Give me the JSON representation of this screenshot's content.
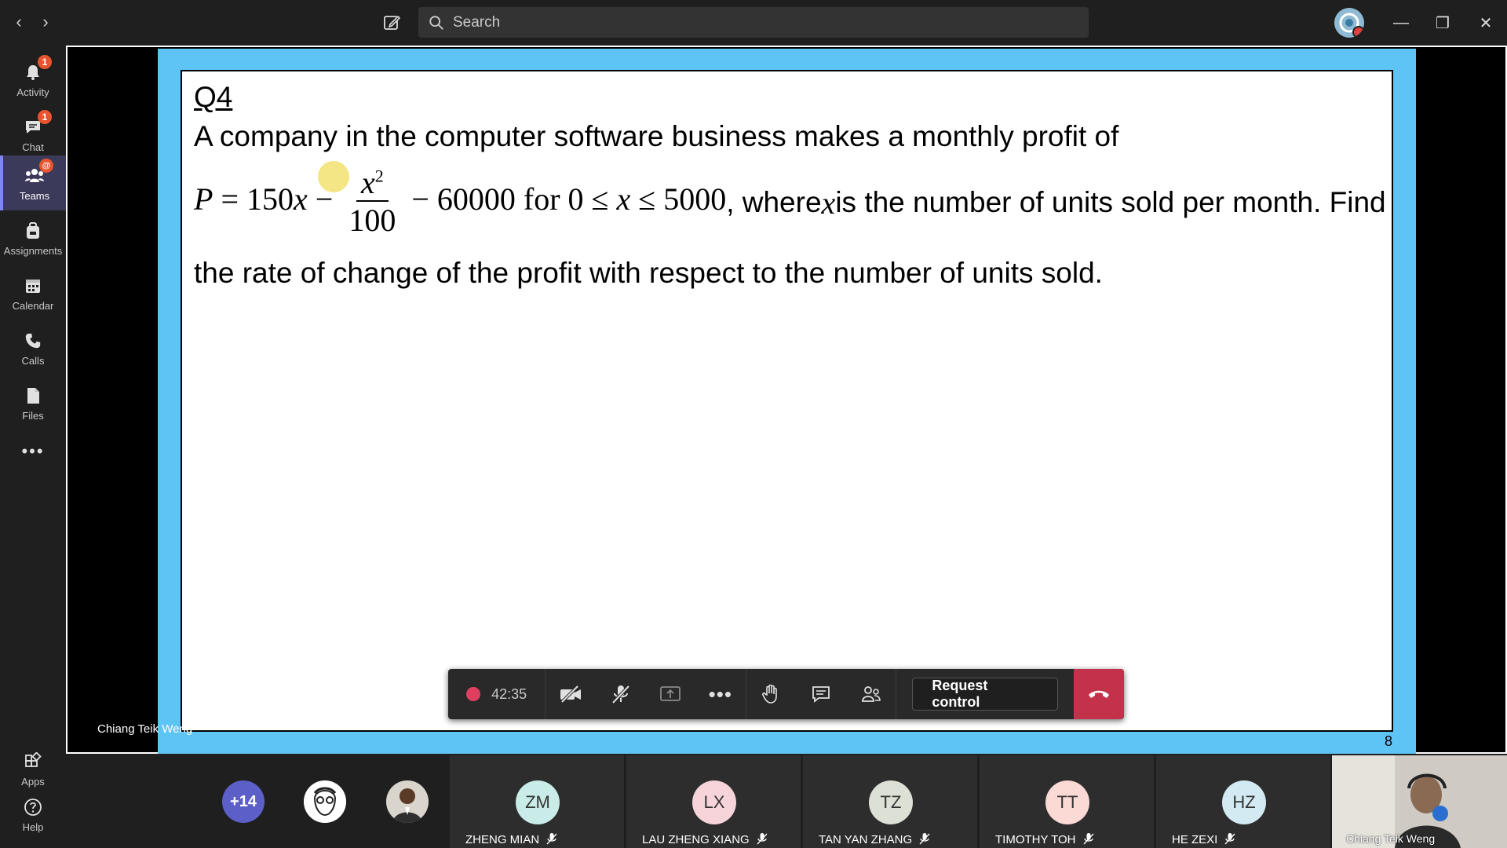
{
  "titlebar": {
    "search_placeholder": "Search",
    "back_icon": "chevron-left-icon",
    "forward_icon": "chevron-right-icon",
    "compose_icon": "compose-icon",
    "minimize": "—",
    "restore": "❐",
    "close": "✕"
  },
  "rail": {
    "items": [
      {
        "label": "Activity",
        "icon": "bell-icon",
        "badge": "1"
      },
      {
        "label": "Chat",
        "icon": "chat-icon",
        "badge": "1"
      },
      {
        "label": "Teams",
        "icon": "teams-icon",
        "badge": "@",
        "active": true
      },
      {
        "label": "Assignments",
        "icon": "backpack-icon"
      },
      {
        "label": "Calendar",
        "icon": "calendar-icon"
      },
      {
        "label": "Calls",
        "icon": "phone-icon"
      },
      {
        "label": "Files",
        "icon": "file-icon"
      },
      {
        "label": "•••",
        "icon": "more-icon"
      },
      {
        "label": "Apps",
        "icon": "apps-icon"
      },
      {
        "label": "Help",
        "icon": "help-icon"
      }
    ]
  },
  "slide": {
    "title": "Q4",
    "line1": "A company in the computer software business makes a monthly profit of",
    "formula": {
      "lhs": "P",
      "eq": " = 150",
      "x": "x",
      "minus1": " − ",
      "num_base": "x",
      "num_exp": "2",
      "den": "100",
      "minus2": " − 60000",
      "for": " for ",
      "range_start": "0 ≤ ",
      "range_x": "x",
      "range_end": " ≤ 5000"
    },
    "line2_tail_a": ", where ",
    "line2_tail_x": "x",
    "line2_tail_b": " is the number of units sold per month. Find",
    "line3": "the rate of change of the profit with respect to the number of units sold.",
    "slide_number": "8"
  },
  "presenter_name": "Chiang Teik Weng",
  "controls": {
    "timer": "42:35",
    "request_control": "Request control"
  },
  "participants": {
    "overflow": "+14",
    "tiles": [
      {
        "initials": "ZM",
        "name": "ZHENG MIAN",
        "color": "#c9ece8"
      },
      {
        "initials": "LX",
        "name": "LAU ZHENG XIANG",
        "color": "#f6d4d9"
      },
      {
        "initials": "TZ",
        "name": "TAN YAN ZHANG",
        "color": "#dde0d5"
      },
      {
        "initials": "TT",
        "name": "TIMOTHY TOH",
        "color": "#fbd9d4"
      },
      {
        "initials": "HZ",
        "name": "HE ZEXI",
        "color": "#d3eaf2"
      }
    ],
    "self_name": "Chiang Teik Weng"
  }
}
